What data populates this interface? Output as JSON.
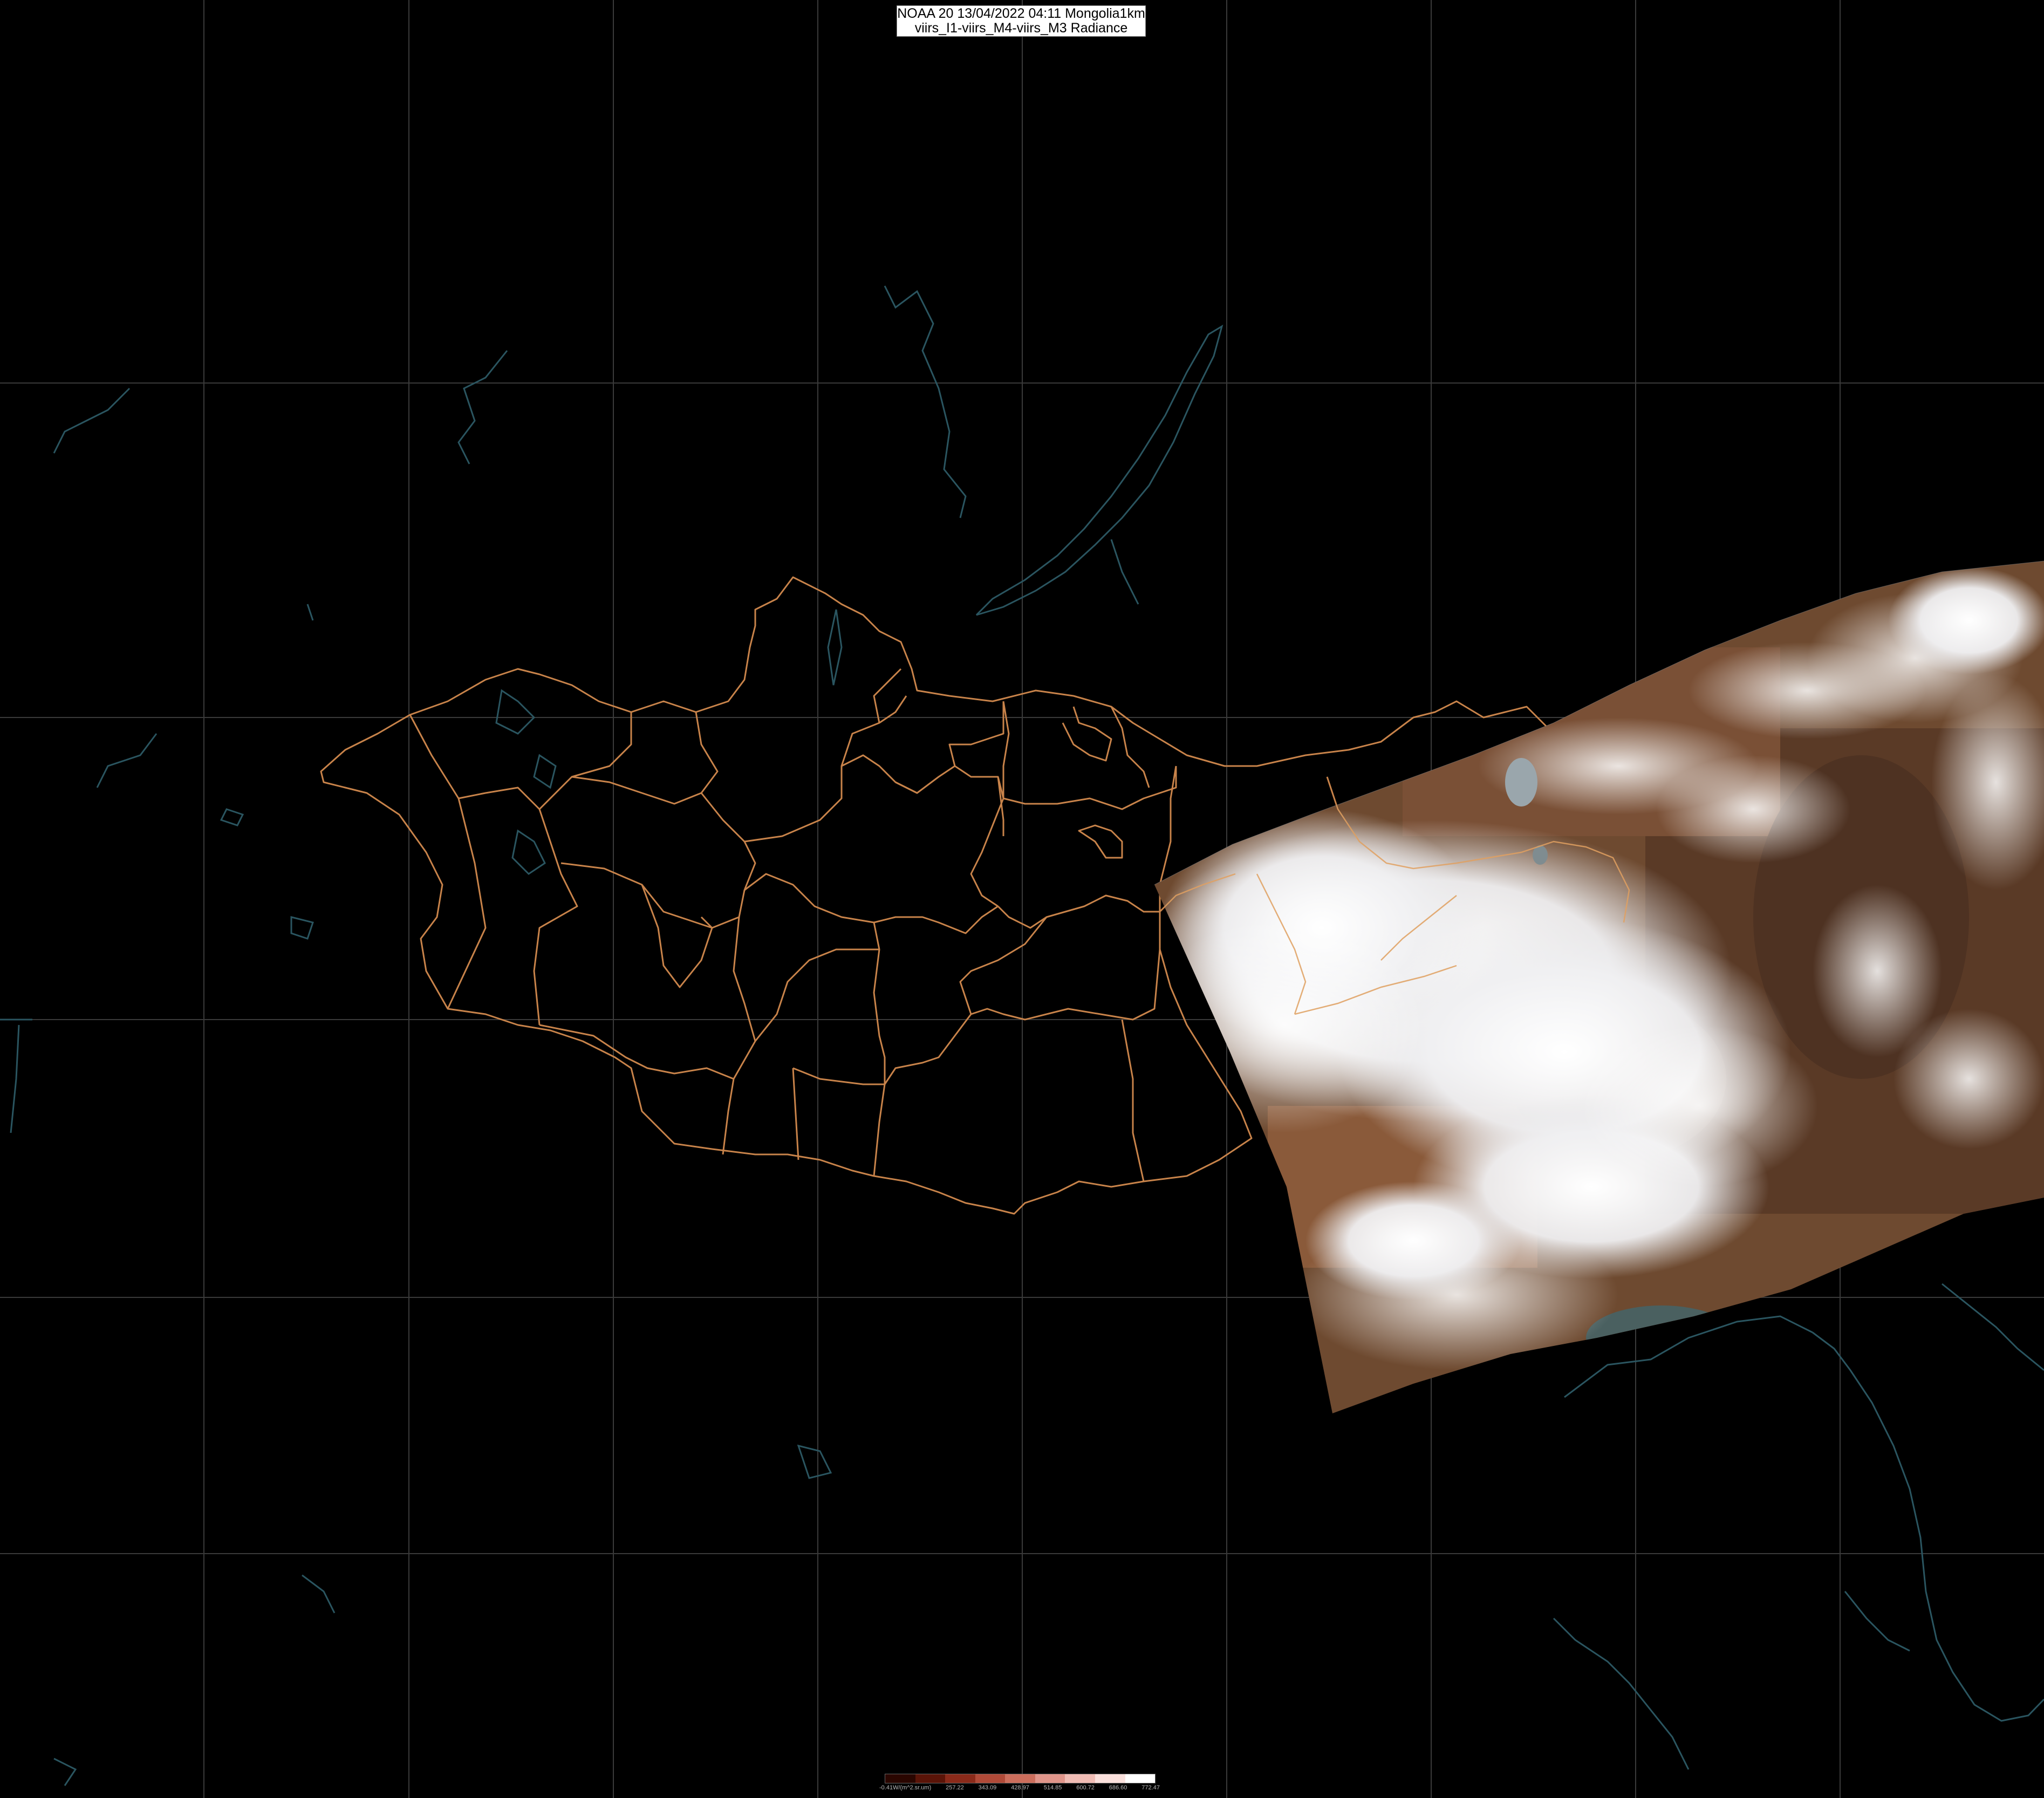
{
  "header": {
    "line1": "NOAA 20 13/04/2022 04:11 Mongolia1km",
    "line2": "viirs_I1-viirs_M4-viirs_M3 Radiance"
  },
  "legend": {
    "ticks": [
      "-0.41W/(m^2.sr.um)",
      "257.22",
      "343.09",
      "428.97",
      "514.85",
      "600.72",
      "686.60",
      "772.47"
    ],
    "colors": [
      "#2a0600",
      "#5a1408",
      "#8a2a1a",
      "#b04a38",
      "#cc6e5c",
      "#e0958a",
      "#f0bcb4",
      "#fae0dc",
      "#ffffff"
    ]
  },
  "colors": {
    "background": "#000000",
    "graticule": "#3a3a3a",
    "admin_border": "#c8834a",
    "coastline": "#2a5560",
    "cloud": "#f2f2f4",
    "land": "#6e4a30"
  }
}
